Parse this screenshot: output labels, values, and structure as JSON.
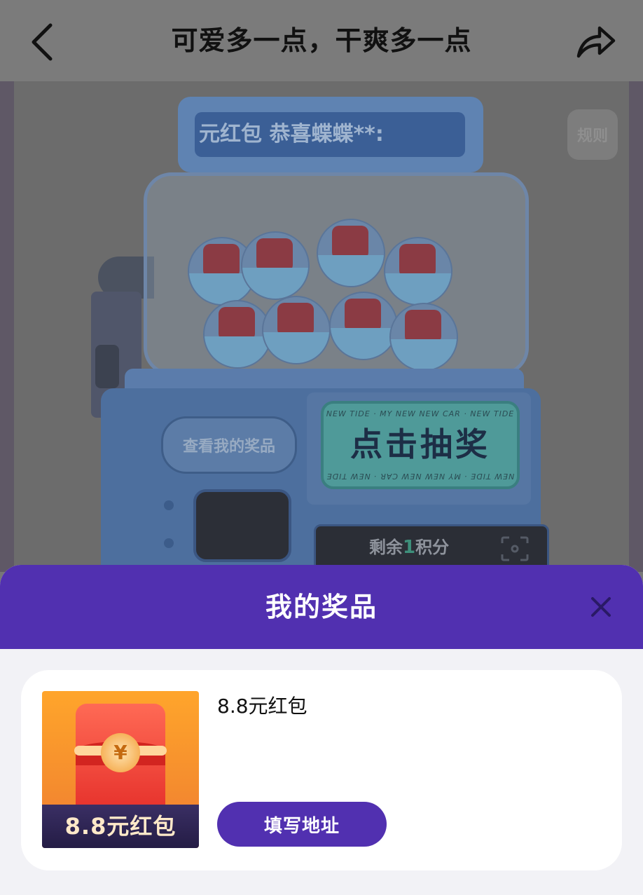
{
  "header": {
    "title": "可爱多一点，干爽多一点",
    "back_icon": "chevron-left-icon",
    "share_icon": "share-arrow-icon"
  },
  "machine": {
    "rules_label": "规则",
    "marquee_text": "元红包  恭喜蝶蝶**:",
    "view_prizes_label": "查看我的奖品",
    "draw_label": "点击抽奖",
    "draw_ring_text": "NEW TIDE · MY NEW NEW CAR · NEW TIDE",
    "credits_prefix": "剩余",
    "credits_value": "1",
    "credits_suffix": "积分"
  },
  "sheet": {
    "title": "我的奖品",
    "close_icon": "close-icon",
    "prize": {
      "thumb_caption": "8.8元红包",
      "name": "8.8元红包",
      "action_label": "填写地址"
    }
  },
  "colors": {
    "accent": "#5130b0",
    "overlay": "#6c6c6c"
  }
}
